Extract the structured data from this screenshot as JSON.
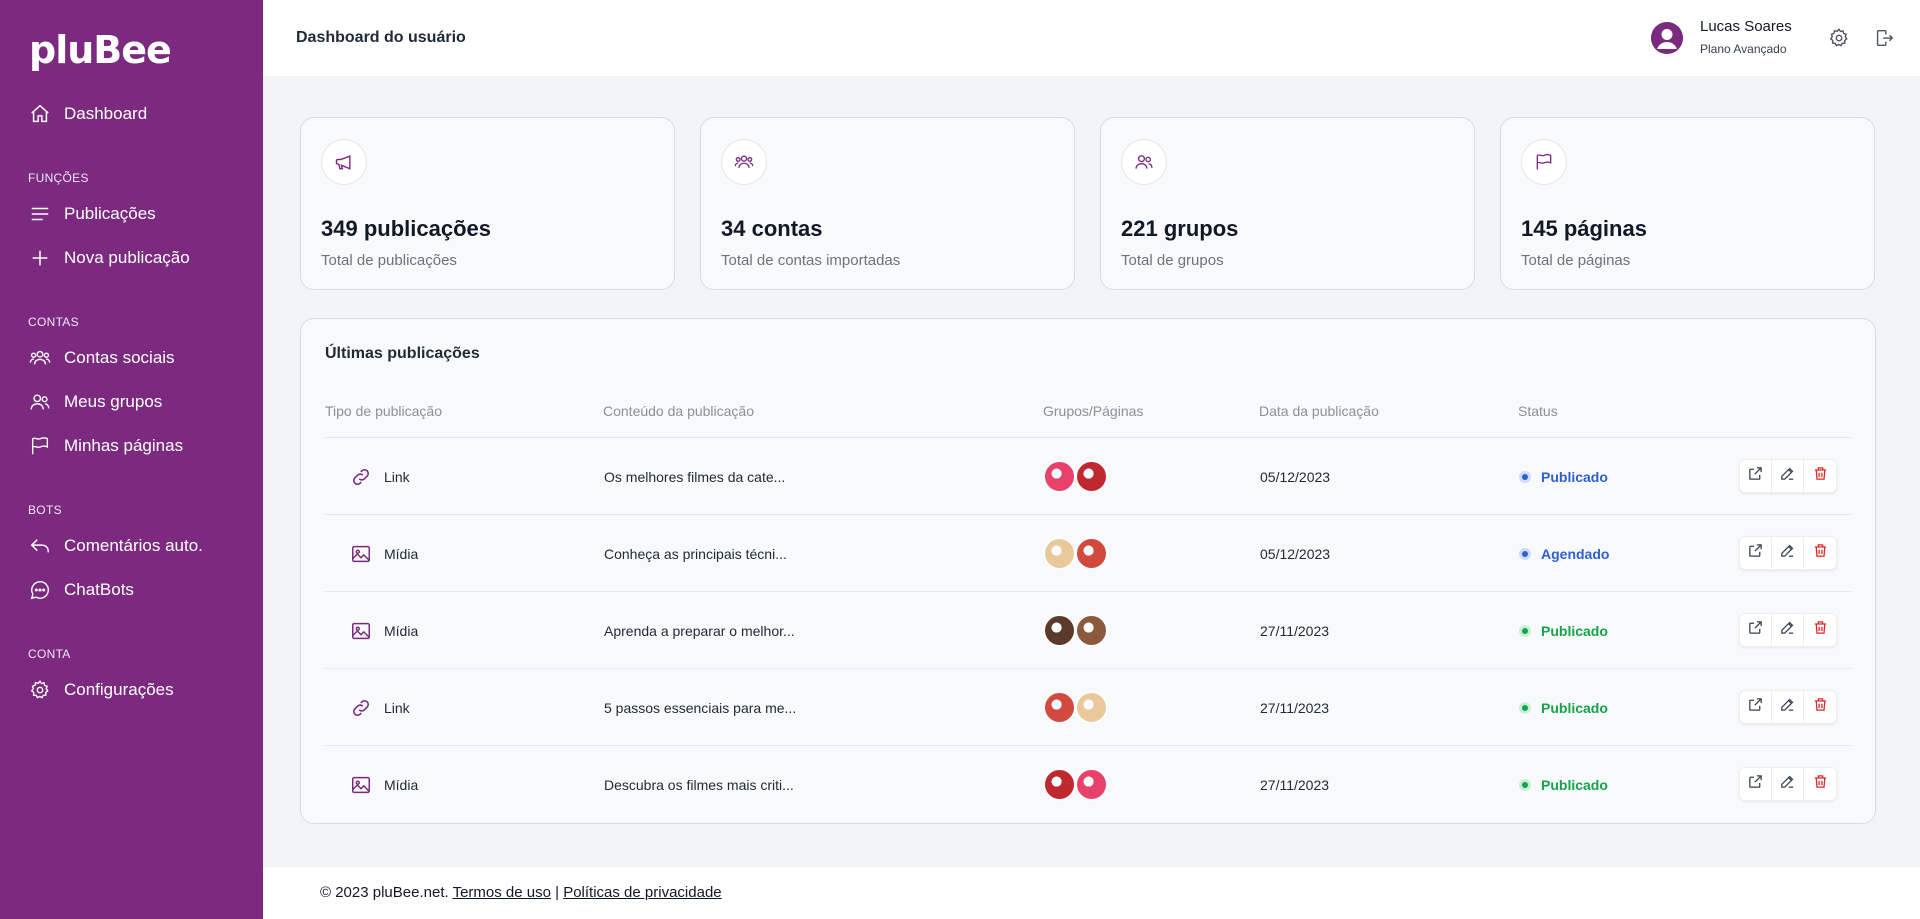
{
  "sidebar": {
    "logo": "pluBee",
    "dashboard": "Dashboard",
    "sections": {
      "funcoes": "FUNÇÕES",
      "contas": "CONTAS",
      "bots": "BOTS",
      "conta": "CONTA"
    },
    "items": {
      "publicacoes": "Publicações",
      "nova_publicacao": "Nova publicação",
      "contas_sociais": "Contas sociais",
      "meus_grupos": "Meus grupos",
      "minhas_paginas": "Minhas páginas",
      "comentarios": "Comentários auto.",
      "chatbots": "ChatBots",
      "configuracoes": "Configurações"
    },
    "icons": [
      "home-icon",
      "list-icon",
      "plus-icon",
      "users-icon",
      "user-group-icon",
      "flag-icon",
      "reply-icon",
      "chat-icon",
      "gear-icon"
    ]
  },
  "header": {
    "title": "Dashboard do usuário",
    "user_name": "Lucas Soares",
    "user_plan": "Plano Avançado"
  },
  "stats": [
    {
      "value": "349 publicações",
      "label": "Total de publicações",
      "icon": "megaphone-icon"
    },
    {
      "value": "34 contas",
      "label": "Total de contas importadas",
      "icon": "users-icon"
    },
    {
      "value": "221 grupos",
      "label": "Total de grupos",
      "icon": "user-group-icon"
    },
    {
      "value": "145 páginas",
      "label": "Total de páginas",
      "icon": "flag-icon"
    }
  ],
  "table": {
    "title": "Últimas publicações",
    "headers": [
      "Tipo de publicação",
      "Conteúdo da publicação",
      "Grupos/Páginas",
      "Data da publicação",
      "Status"
    ],
    "rows": [
      {
        "type": "Link",
        "content": "Os melhores filmes da cate...",
        "date": "05/12/2023",
        "status": "Publicado",
        "status_kind": "blue",
        "thumbs": [
          "#e8416a",
          "#c0282f"
        ]
      },
      {
        "type": "Mídia",
        "content": "Conheça as principais técni...",
        "date": "05/12/2023",
        "status": "Agendado",
        "status_kind": "blue",
        "thumbs": [
          "#e9c99a",
          "#d2493e"
        ]
      },
      {
        "type": "Mídia",
        "content": "Aprenda a preparar o melhor...",
        "date": "27/11/2023",
        "status": "Publicado",
        "status_kind": "green",
        "thumbs": [
          "#5b3a2a",
          "#8b5a3c"
        ]
      },
      {
        "type": "Link",
        "content": "5 passos essenciais para me...",
        "date": "27/11/2023",
        "status": "Publicado",
        "status_kind": "green",
        "thumbs": [
          "#d2493e",
          "#e9c99a"
        ]
      },
      {
        "type": "Mídia",
        "content": "Descubra os filmes mais criti...",
        "date": "27/11/2023",
        "status": "Publicado",
        "status_kind": "green",
        "thumbs": [
          "#c0282f",
          "#e8416a"
        ]
      }
    ]
  },
  "footer": {
    "copyright": "© 2023 pluBee.net.",
    "terms": "Termos de uso",
    "separator": "|",
    "privacy": "Políticas de privacidade"
  },
  "colors": {
    "brand": "#7b2a7f",
    "status_blue": "#2f5fd0",
    "status_green": "#16a34a",
    "danger": "#dc2626"
  }
}
